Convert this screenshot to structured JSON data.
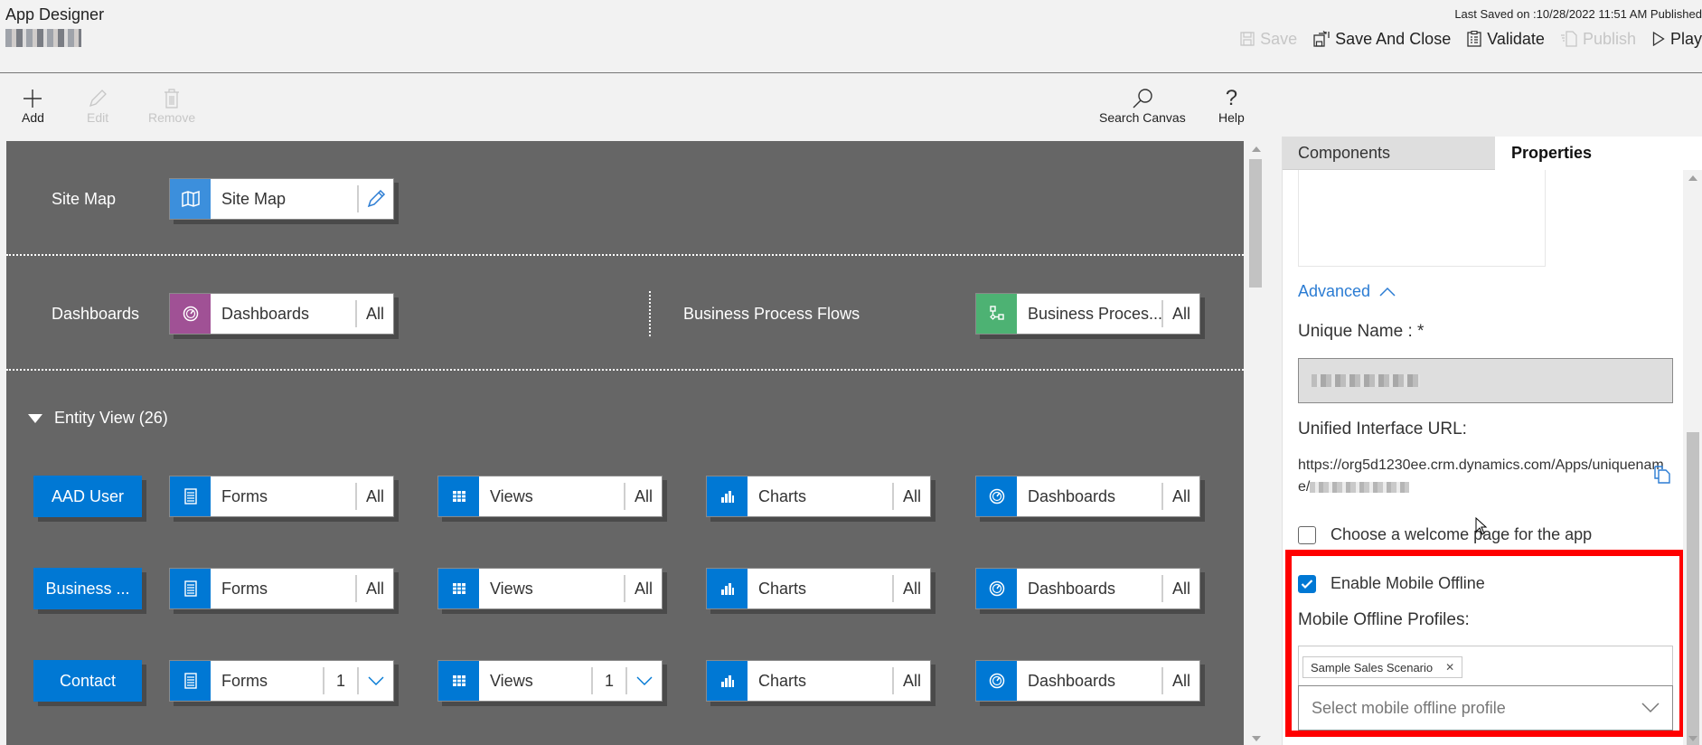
{
  "header": {
    "title": "App Designer",
    "last_saved": "Last Saved on :10/28/2022 11:51 AM Published",
    "commands": [
      {
        "label": "Save",
        "icon": "save-icon",
        "disabled": true
      },
      {
        "label": "Save And Close",
        "icon": "save-close-icon",
        "disabled": false
      },
      {
        "label": "Validate",
        "icon": "clipboard-checklist-icon",
        "disabled": false
      },
      {
        "label": "Publish",
        "icon": "publish-icon",
        "disabled": true
      },
      {
        "label": "Play",
        "icon": "play-icon",
        "disabled": false
      }
    ]
  },
  "toolbar": {
    "add": "Add",
    "edit": "Edit",
    "remove": "Remove",
    "search_canvas": "Search Canvas",
    "help": "Help"
  },
  "canvas": {
    "site_map": {
      "label": "Site Map",
      "tile": "Site Map",
      "color": "#3c8fdc"
    },
    "dashboards": {
      "label": "Dashboards",
      "tile": "Dashboards",
      "count": "All",
      "color": "#a05195"
    },
    "bpf": {
      "label": "Business Process Flows",
      "tile": "Business Proces...",
      "count": "All",
      "color": "#4db273"
    },
    "entity_view": {
      "label": "Entity View (26)",
      "expanded": true
    },
    "entities": [
      {
        "name": "AAD User",
        "forms": "All",
        "views": "All",
        "charts": "All",
        "dashboards": "All"
      },
      {
        "name": "Business ...",
        "forms": "All",
        "views": "All",
        "charts": "All",
        "dashboards": "All"
      },
      {
        "name": "Contact",
        "forms": "1",
        "views": "1",
        "charts": "All",
        "dashboards": "All"
      }
    ],
    "tile_labels": {
      "forms": "Forms",
      "views": "Views",
      "charts": "Charts",
      "dashboards": "Dashboards"
    },
    "accent": "#0078d4"
  },
  "panel": {
    "tabs": [
      {
        "label": "Components",
        "active": false
      },
      {
        "label": "Properties",
        "active": true
      }
    ],
    "advanced": "Advanced",
    "unique_name_label": "Unique Name : *",
    "unified_url_label": "Unified Interface URL:",
    "url_prefix": "https://org5d1230ee.crm.dynamics.com/Apps/uniquename/",
    "welcome_page": {
      "label": "Choose a welcome page for the app",
      "checked": false
    },
    "mobile_offline": {
      "label": "Enable Mobile Offline",
      "checked": true
    },
    "profiles_label": "Mobile Offline Profiles:",
    "selected_profiles": [
      "Sample Sales Scenario"
    ],
    "profile_placeholder": "Select mobile offline profile",
    "highlight_color": "#ff0000"
  }
}
